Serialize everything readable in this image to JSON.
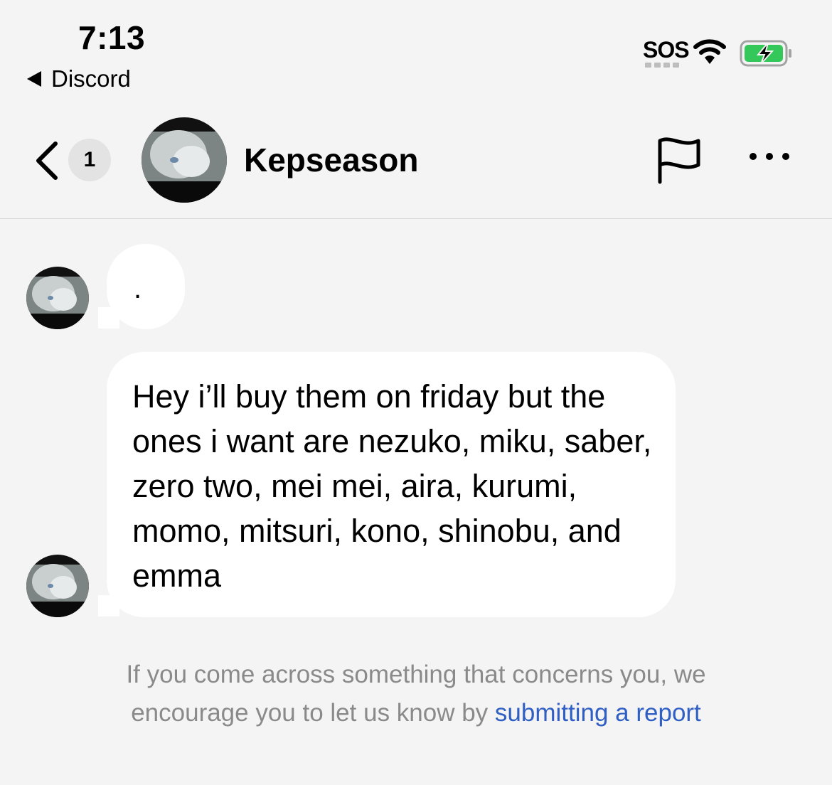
{
  "status_bar": {
    "time": "7:13",
    "back_app": "Discord",
    "sos": "SOS"
  },
  "header": {
    "unread_count": "1",
    "username": "Kepseason"
  },
  "messages": [
    {
      "text": "."
    },
    {
      "text": "Hey i’ll buy them on friday but the ones i want are nezuko, miku, saber, zero two, mei mei, aira, kurumi, momo, mitsuri, kono, shinobu, and emma"
    }
  ],
  "footer": {
    "text": "If you come across something that concerns you, we encourage you to let us know by ",
    "link": "submitting a report"
  },
  "colors": {
    "background": "#f4f4f4",
    "bubble": "#ffffff",
    "link": "#2f5ec4",
    "battery_fill": "#34c759"
  },
  "icons": [
    "back-triangle-icon",
    "wifi-icon",
    "battery-charging-icon",
    "chevron-left-icon",
    "flag-icon",
    "more-icon"
  ]
}
